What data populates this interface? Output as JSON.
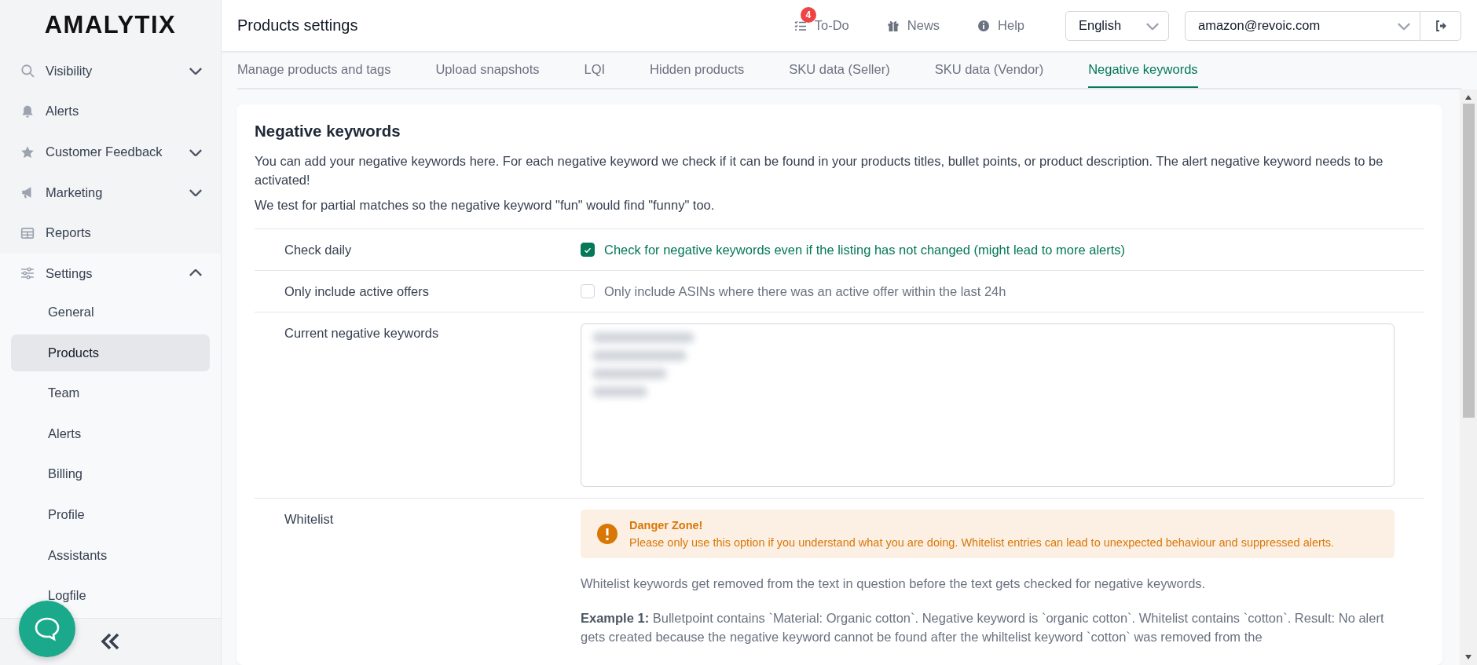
{
  "logo": "AMALYTIX",
  "sidebar": {
    "items": [
      {
        "label": "Visibility",
        "expanded": false
      },
      {
        "label": "Alerts"
      },
      {
        "label": "Customer Feedback",
        "expanded": false
      },
      {
        "label": "Marketing",
        "expanded": false
      },
      {
        "label": "Reports"
      },
      {
        "label": "Settings",
        "expanded": true,
        "children": [
          {
            "label": "General",
            "selected": false
          },
          {
            "label": "Products",
            "selected": true
          },
          {
            "label": "Team",
            "selected": false
          },
          {
            "label": "Alerts",
            "selected": false
          },
          {
            "label": "Billing",
            "selected": false
          },
          {
            "label": "Profile",
            "selected": false
          },
          {
            "label": "Assistants",
            "selected": false
          },
          {
            "label": "Logfile",
            "selected": false
          }
        ]
      }
    ]
  },
  "header": {
    "title": "Products settings",
    "nav": [
      {
        "label": "To-Do",
        "badge": "4"
      },
      {
        "label": "News"
      },
      {
        "label": "Help"
      }
    ],
    "language": {
      "value": "English"
    },
    "account": {
      "value": "amazon@revoic.com"
    }
  },
  "tabs": [
    {
      "label": "Manage products and tags",
      "selected": false
    },
    {
      "label": "Upload snapshots",
      "selected": false
    },
    {
      "label": "LQI",
      "selected": false
    },
    {
      "label": "Hidden products",
      "selected": false
    },
    {
      "label": "SKU data (Seller)",
      "selected": false
    },
    {
      "label": "SKU data (Vendor)",
      "selected": false
    },
    {
      "label": "Negative keywords",
      "selected": true
    }
  ],
  "card": {
    "title": "Negative keywords",
    "paragraphs": [
      "You can add your negative keywords here. For each negative keyword we check if it can be found in your products titles, bullet points, or product description. The alert negative keyword needs to be activated!",
      "We test for partial matches so the negative keyword \"fun\" would find \"funny\" too."
    ],
    "rows": [
      {
        "kind": "checkbox",
        "label": "Check daily",
        "text": "Check for negative keywords even if the listing has not changed (might lead to more alerts)",
        "checked": true
      },
      {
        "kind": "checkbox",
        "label": "Only include active offers",
        "text": "Only include ASINs where there was an active offer within the last 24h",
        "checked": false
      },
      {
        "kind": "textarea",
        "label": "Current negative keywords"
      },
      {
        "kind": "whitelist",
        "label": "Whitelist",
        "alert": {
          "title": "Danger Zone!",
          "text": "Please only use this option if you understand what you are doing. Whitelist entries can lead to unexpected behaviour and suppressed alerts."
        },
        "description": "Whitelist keywords get removed from the text in question before the text gets checked for negative keywords.",
        "example": "**Example 1:** Bulletpoint contains `Material: Organic cotton`. Negative keyword is `organic cotton`. Whitelist contains `cotton`. Result: No alert gets created because the negative keyword cannot be found after the whiltelist keyword `cotton` was removed from the"
      }
    ]
  }
}
